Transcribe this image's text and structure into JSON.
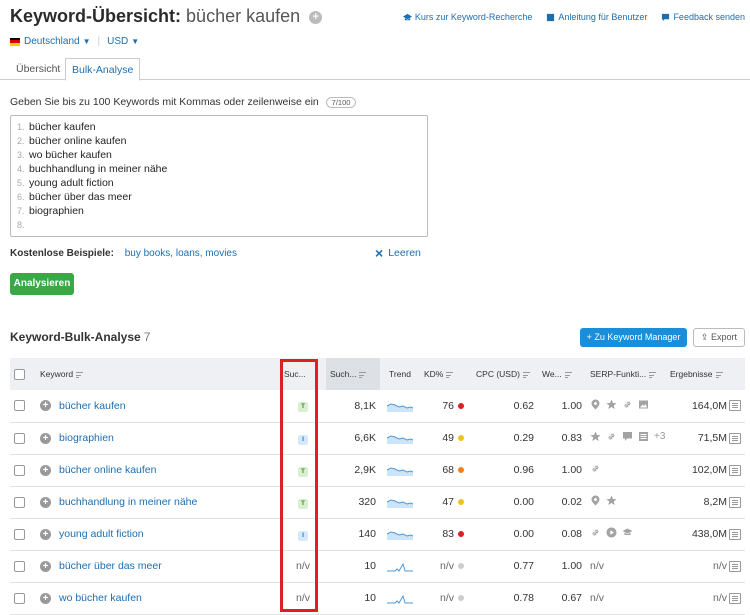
{
  "header": {
    "title": "Keyword-Übersicht:",
    "query": "bücher kaufen",
    "links": [
      {
        "label": "Kurs zur Keyword-Recherche",
        "icon": "graduation-icon"
      },
      {
        "label": "Anleitung für Benutzer",
        "icon": "book-icon"
      },
      {
        "label": "Feedback senden",
        "icon": "chat-icon"
      }
    ]
  },
  "database": {
    "country": "Deutschland",
    "currency": "USD"
  },
  "tabs": [
    {
      "label": "Übersicht",
      "active": false
    },
    {
      "label": "Bulk-Analyse",
      "active": true
    }
  ],
  "input": {
    "instruction": "Geben Sie bis zu 100 Keywords mit Kommas oder zeilenweise ein",
    "counter": "7/100",
    "lines": [
      {
        "num": "1.",
        "text": "bücher kaufen"
      },
      {
        "num": "2.",
        "text": "bücher online kaufen"
      },
      {
        "num": "3.",
        "text": "wo bücher kaufen"
      },
      {
        "num": "4.",
        "text": "buchhandlung in meiner nähe"
      },
      {
        "num": "5.",
        "text": "young adult fiction"
      },
      {
        "num": "6.",
        "text": "bücher über das meer"
      },
      {
        "num": "7.",
        "text": "biographien"
      },
      {
        "num": "8.",
        "text": ""
      }
    ],
    "examples_label": "Kostenlose Beispiele:",
    "examples_links": "buy books, loans, movies",
    "clear_label": "Leeren",
    "analyze_label": "Analysieren"
  },
  "results": {
    "title": "Keyword-Bulk-Analyse",
    "count": "7",
    "km_button": "Zu Keyword Manager",
    "export_button": "Export",
    "columns": [
      "Keyword",
      "Suc...",
      "Such...",
      "Trend",
      "KD%",
      "CPC (USD)",
      "We...",
      "SERP-Funkti...",
      "Ergebnisse"
    ],
    "rows": [
      {
        "keyword": "bücher kaufen",
        "intent": "T",
        "volume": "8,1K",
        "kd": "76",
        "kd_color": "#e02020",
        "cpc": "0.62",
        "we": "1.00",
        "serp": [
          "pin-icon",
          "star-icon",
          "link-icon",
          "image-icon"
        ],
        "serp_extra": "",
        "results": "164,0M"
      },
      {
        "keyword": "biographien",
        "intent": "I",
        "volume": "6,6K",
        "kd": "49",
        "kd_color": "#f0c020",
        "cpc": "0.29",
        "we": "0.83",
        "serp": [
          "star-icon",
          "link-icon",
          "faq-icon",
          "list-icon"
        ],
        "serp_extra": "+3",
        "results": "71,5M"
      },
      {
        "keyword": "bücher online kaufen",
        "intent": "T",
        "volume": "2,9K",
        "kd": "68",
        "kd_color": "#f08020",
        "cpc": "0.96",
        "we": "1.00",
        "serp": [
          "link-icon"
        ],
        "serp_extra": "",
        "results": "102,0M"
      },
      {
        "keyword": "buchhandlung in meiner nähe",
        "intent": "T",
        "volume": "320",
        "kd": "47",
        "kd_color": "#f0c020",
        "cpc": "0.00",
        "we": "0.02",
        "serp": [
          "pin-icon",
          "star-icon"
        ],
        "serp_extra": "",
        "results": "8,2M"
      },
      {
        "keyword": "young adult fiction",
        "intent": "I",
        "volume": "140",
        "kd": "83",
        "kd_color": "#e02020",
        "cpc": "0.00",
        "we": "0.08",
        "serp": [
          "link-icon",
          "video-icon",
          "graduation-icon"
        ],
        "serp_extra": "",
        "results": "438,0M"
      },
      {
        "keyword": "bücher über das meer",
        "intent": "n/v",
        "volume": "10",
        "kd": "n/v",
        "kd_color": "#cccccc",
        "cpc": "0.77",
        "we": "1.00",
        "serp": [],
        "serp_text": "n/v",
        "results": "n/v"
      },
      {
        "keyword": "wo bücher kaufen",
        "intent": "n/v",
        "volume": "10",
        "kd": "n/v",
        "kd_color": "#cccccc",
        "cpc": "0.78",
        "we": "0.67",
        "serp": [],
        "serp_text": "n/v",
        "results": "n/v"
      }
    ]
  },
  "colors": {
    "link": "#1a6fb3",
    "analyze": "#3aa845",
    "km_button": "#1a8ed8",
    "highlight": "#e02020"
  }
}
